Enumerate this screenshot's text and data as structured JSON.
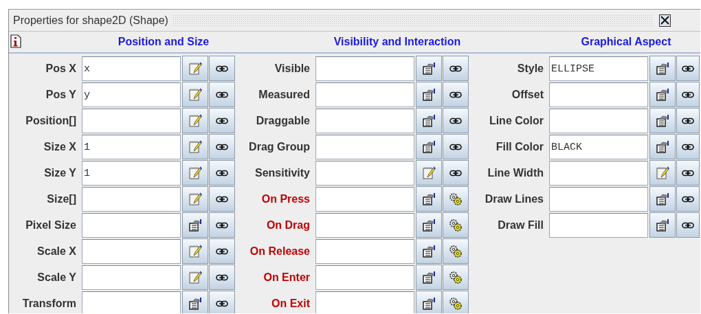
{
  "window": {
    "title": "Properties for shape2D (Shape)"
  },
  "sections": [
    {
      "title": "Position and Size",
      "rows": [
        {
          "label": "Pos X",
          "value": "x",
          "kind": "text"
        },
        {
          "label": "Pos Y",
          "value": "y",
          "kind": "text"
        },
        {
          "label": "Position[]",
          "kind": "text"
        },
        {
          "label": "Size X",
          "value": "1",
          "kind": "text"
        },
        {
          "label": "Size Y",
          "value": "1",
          "kind": "text"
        },
        {
          "label": "Size[]",
          "kind": "text"
        },
        {
          "label": "Pixel Size",
          "kind": "list"
        },
        {
          "label": "Scale X",
          "kind": "text"
        },
        {
          "label": "Scale Y",
          "kind": "text"
        },
        {
          "label": "Transform",
          "kind": "list"
        }
      ]
    },
    {
      "title": "Visibility and Interaction",
      "rows": [
        {
          "label": "Visible",
          "kind": "list"
        },
        {
          "label": "Measured",
          "kind": "list"
        },
        {
          "label": "Draggable",
          "kind": "list"
        },
        {
          "label": "Drag Group",
          "kind": "list"
        },
        {
          "label": "Sensitivity",
          "kind": "text"
        },
        {
          "label": "On Press",
          "kind": "action"
        },
        {
          "label": "On Drag",
          "kind": "action"
        },
        {
          "label": "On Release",
          "kind": "action"
        },
        {
          "label": "On Enter",
          "kind": "action"
        },
        {
          "label": "On Exit",
          "kind": "action"
        }
      ]
    },
    {
      "title": "Graphical Aspect",
      "rows": [
        {
          "label": "Style",
          "value": "ELLIPSE",
          "kind": "list"
        },
        {
          "label": "Offset",
          "kind": "list"
        },
        {
          "label": "Line Color",
          "kind": "list"
        },
        {
          "label": "Fill Color",
          "value": "BLACK",
          "kind": "list"
        },
        {
          "label": "Line Width",
          "kind": "text"
        },
        {
          "label": "Draw Lines",
          "kind": "list"
        },
        {
          "label": "Draw Fill",
          "kind": "list"
        }
      ]
    }
  ]
}
